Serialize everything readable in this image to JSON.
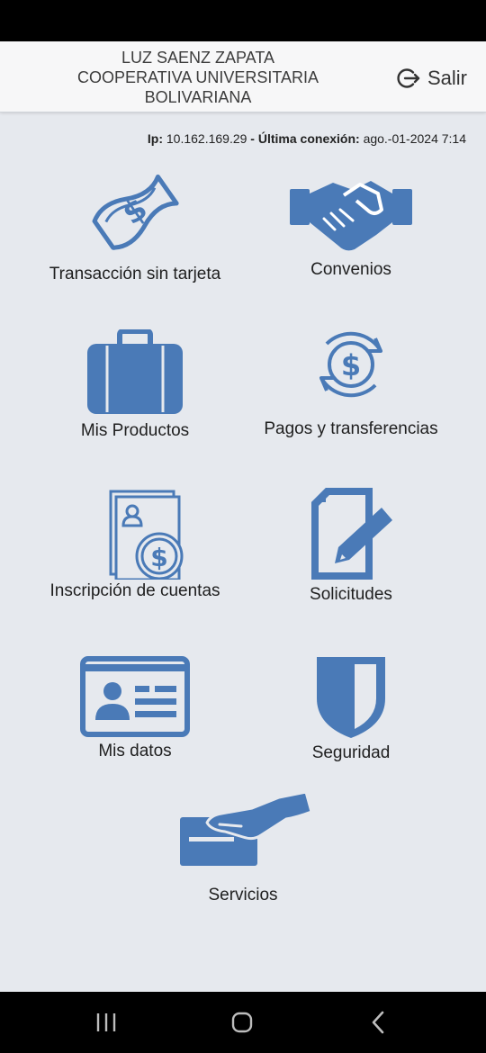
{
  "header": {
    "title_lines": [
      "LUZ SAENZ ZAPATA",
      "COOPERATIVA UNIVERSITARIA",
      "BOLIVARIANA"
    ],
    "logout_label": "Salir"
  },
  "connection": {
    "ip_label": "Ip:",
    "ip_value": "10.162.169.29",
    "separator": " - ",
    "last_label": "Última conexión:",
    "last_value": "ago.-01-2024 7:14"
  },
  "menu": [
    {
      "label": "Transacción sin tarjeta",
      "icon": "money-bill-icon"
    },
    {
      "label": "Convenios",
      "icon": "handshake-icon"
    },
    {
      "label": "Mis Productos",
      "icon": "briefcase-icon"
    },
    {
      "label": "Pagos y transferencias",
      "icon": "dollar-cycle-icon"
    },
    {
      "label": "Inscripción de cuentas",
      "icon": "account-docs-icon"
    },
    {
      "label": "Solicitudes",
      "icon": "document-edit-icon"
    },
    {
      "label": "Mis datos",
      "icon": "id-card-icon"
    },
    {
      "label": "Seguridad",
      "icon": "shield-icon"
    },
    {
      "label": "Servicios",
      "icon": "hand-card-icon"
    }
  ],
  "colors": {
    "icon_blue": "#4a7ab7",
    "background": "#e6e9ee"
  }
}
